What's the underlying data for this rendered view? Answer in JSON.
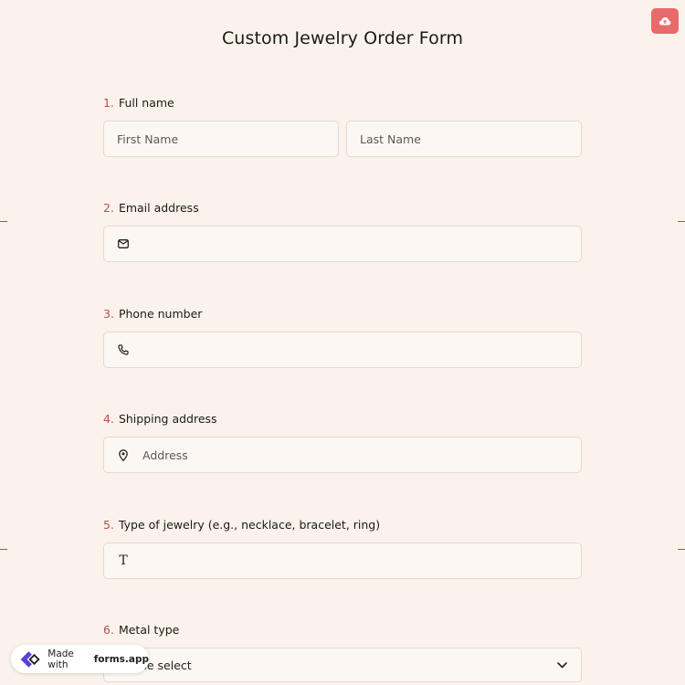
{
  "header": {
    "title": "Custom Jewelry Order Form",
    "save_icon": "cloud-upload-icon",
    "accent_color": "#e86a6a"
  },
  "questions": [
    {
      "number": "1.",
      "label": "Full name",
      "first_placeholder": "First Name",
      "last_placeholder": "Last Name"
    },
    {
      "number": "2.",
      "label": "Email address",
      "icon": "envelope-icon",
      "placeholder": ""
    },
    {
      "number": "3.",
      "label": "Phone number",
      "icon": "phone-icon",
      "placeholder": ""
    },
    {
      "number": "4.",
      "label": "Shipping address",
      "icon": "location-pin-icon",
      "placeholder": "Address"
    },
    {
      "number": "5.",
      "label": "Type of jewelry (e.g., necklace, bracelet, ring)",
      "icon": "text-icon",
      "placeholder": ""
    },
    {
      "number": "6.",
      "label": "Metal type",
      "select_value": "Please select",
      "icon": "chevron-down-icon"
    }
  ],
  "badge": {
    "prefix": "Made with",
    "brand": "forms.app"
  },
  "colors": {
    "background": "#fbf3eb",
    "number": "#b5524f"
  }
}
